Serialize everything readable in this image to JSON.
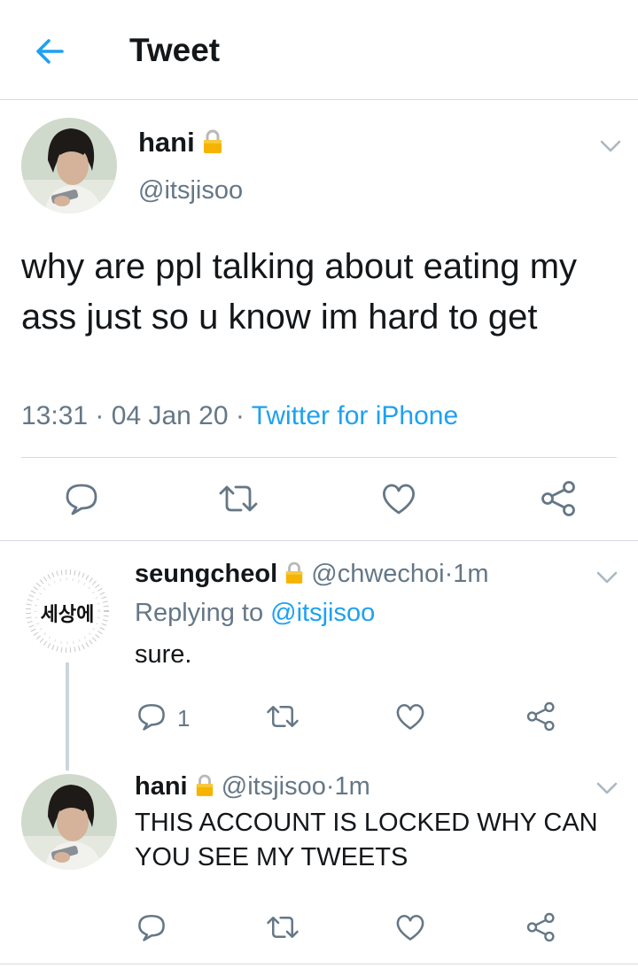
{
  "header": {
    "title": "Tweet",
    "back_icon": "arrow-left-icon"
  },
  "colors": {
    "accent": "#1da1f2",
    "text": "#14171a",
    "muted": "#657786",
    "divider": "#d6dbe0",
    "lock": "#f5b400"
  },
  "main_tweet": {
    "name": "hani",
    "handle": "@itsjisoo",
    "text": "why are ppl talking about eating my ass just so u know im hard to get",
    "time": "13:31",
    "date": "04 Jan 20",
    "source": "Twitter for iPhone",
    "separator": "·"
  },
  "replies": [
    {
      "name": "seungcheol",
      "handle": "@chwechoi",
      "age": "1m",
      "replying_prefix": "Replying to",
      "replying_to": "@itsjisoo",
      "text": "sure.",
      "reply_count": "1",
      "avatar_text": "세상에"
    },
    {
      "name": "hani",
      "handle": "@itsjisoo",
      "age": "1m",
      "text": "THIS ACCOUNT IS LOCKED WHY CAN YOU SEE MY TWEETS"
    }
  ],
  "dot": "·"
}
